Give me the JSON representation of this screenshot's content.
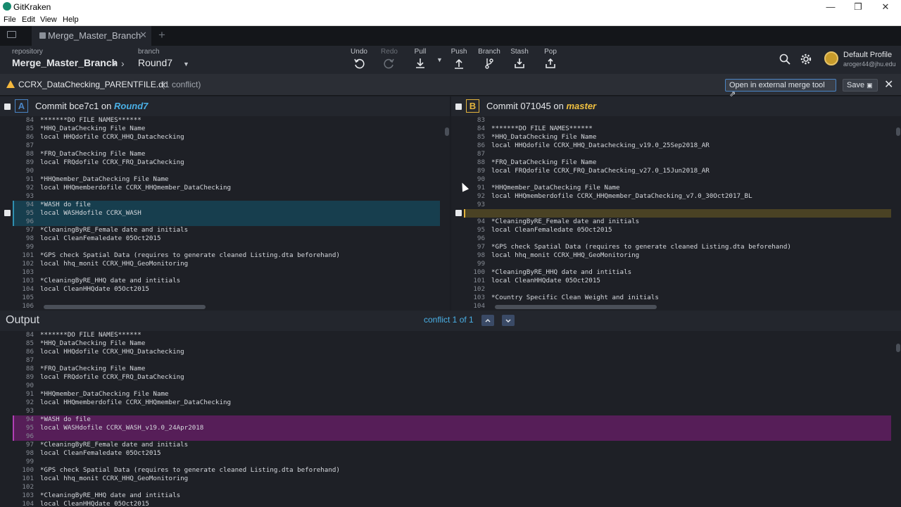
{
  "window": {
    "title": "GitKraken",
    "minimize": "—",
    "maximize": "❐",
    "close": "✕"
  },
  "menu": [
    "File",
    "Edit",
    "View",
    "Help"
  ],
  "tab": {
    "label": "Merge_Master_Branch",
    "close": "✕",
    "add": "+"
  },
  "toolbar": {
    "repository_label": "repository",
    "repository": "Merge_Master_Branch",
    "branch_label": "branch",
    "branch": "Round7",
    "actions": {
      "undo": "Undo",
      "redo": "Redo",
      "pull": "Pull",
      "push": "Push",
      "branch": "Branch",
      "stash": "Stash",
      "pop": "Pop"
    },
    "profile_name": "Default Profile",
    "profile_email": "aroger44@jhu.edu"
  },
  "conflict_bar": {
    "file": "CCRX_DataChecking_PARENTFILE.do",
    "count": "(1 conflict)",
    "external_button": "Open in external merge tool",
    "save_button": "Save"
  },
  "pane_a": {
    "badge": "A",
    "title": "Commit bce7c1 on",
    "branch": "Round7",
    "lines": [
      [
        "84",
        "*******DO FILE NAMES******"
      ],
      [
        "85",
        "*HHQ_DataChecking File Name"
      ],
      [
        "86",
        "local HHQdofile CCRX_HHQ_Datachecking"
      ],
      [
        "87",
        ""
      ],
      [
        "88",
        "*FRQ_DataChecking File Name"
      ],
      [
        "89",
        "local FRQdofile CCRX_FRQ_DataChecking"
      ],
      [
        "90",
        ""
      ],
      [
        "91",
        "*HHQmember_DataChecking File Name"
      ],
      [
        "92",
        "local HHQmemberdofile CCRX_HHQmember_DataChecking"
      ],
      [
        "93",
        ""
      ],
      [
        "94",
        "*WASH do file"
      ],
      [
        "95",
        "local WASHdofile CCRX_WASH"
      ],
      [
        "96",
        ""
      ],
      [
        "97",
        "*CleaningByRE_Female date and initials"
      ],
      [
        "98",
        "local CleanFemaledate 05Oct2015"
      ],
      [
        "99",
        ""
      ],
      [
        "101",
        "*GPS check Spatial Data (requires to generate cleaned Listing.dta beforehand)"
      ],
      [
        "102",
        "local hhq_monit CCRX_HHQ_GeoMonitoring"
      ],
      [
        "103",
        ""
      ],
      [
        "103",
        "*CleaningByRE_HHQ date and intitials"
      ],
      [
        "104",
        "local CleanHHQdate 05Oct2015"
      ],
      [
        "105",
        ""
      ],
      [
        "106",
        ""
      ]
    ]
  },
  "pane_b": {
    "badge": "B",
    "title": "Commit 071045 on",
    "branch": "master",
    "lines": [
      [
        "83",
        ""
      ],
      [
        "84",
        "*******DO FILE NAMES******"
      ],
      [
        "85",
        "*HHQ_DataChecking File Name"
      ],
      [
        "86",
        "local HHQdofile CCRX_HHQ_Datachecking_v19.0_25Sep2018_AR"
      ],
      [
        "87",
        ""
      ],
      [
        "88",
        "*FRQ_DataChecking File Name"
      ],
      [
        "89",
        "local FRQdofile CCRX_FRQ_DataChecking_v27.0_15Jun2018_AR"
      ],
      [
        "90",
        ""
      ],
      [
        "91",
        "*HHQmember_DataChecking File Name"
      ],
      [
        "92",
        "local HHQmemberdofile CCRX_HHQmember_DataChecking_v7.0_30Oct2017_BL"
      ],
      [
        "93",
        ""
      ],
      [
        "",
        ""
      ],
      [
        "94",
        "*CleaningByRE_Female date and initials"
      ],
      [
        "95",
        "local CleanFemaledate 05Oct2015"
      ],
      [
        "96",
        ""
      ],
      [
        "97",
        "*GPS check Spatial Data (requires to generate cleaned Listing.dta beforehand)"
      ],
      [
        "98",
        "local hhq_monit CCRX_HHQ_GeoMonitoring"
      ],
      [
        "99",
        ""
      ],
      [
        "100",
        "*CleaningByRE_HHQ date and intitials"
      ],
      [
        "101",
        "local CleanHHQdate 05Oct2015"
      ],
      [
        "102",
        ""
      ],
      [
        "103",
        "*Country Specific Clean Weight and initials"
      ],
      [
        "104",
        ""
      ]
    ]
  },
  "output": {
    "title": "Output",
    "conflict_nav": "conflict 1 of 1",
    "lines": [
      [
        "84",
        "*******DO FILE NAMES******"
      ],
      [
        "85",
        "*HHQ_DataChecking File Name"
      ],
      [
        "86",
        "local HHQdofile CCRX_HHQ_Datachecking"
      ],
      [
        "87",
        ""
      ],
      [
        "88",
        "*FRQ_DataChecking File Name"
      ],
      [
        "89",
        "local FRQdofile CCRX_FRQ_DataChecking"
      ],
      [
        "90",
        ""
      ],
      [
        "91",
        "*HHQmember_DataChecking File Name"
      ],
      [
        "92",
        "local HHQmemberdofile CCRX_HHQmember_DataChecking"
      ],
      [
        "93",
        ""
      ],
      [
        "94",
        "*WASH do file"
      ],
      [
        "95",
        "local WASHdofile CCRX_WASH_v19.0_24Apr2018"
      ],
      [
        "96",
        ""
      ],
      [
        "97",
        "*CleaningByRE_Female date and initials"
      ],
      [
        "98",
        "local CleanFemaledate 05Oct2015"
      ],
      [
        "99",
        ""
      ],
      [
        "100",
        "*GPS check Spatial Data (requires to generate cleaned Listing.dta beforehand)"
      ],
      [
        "101",
        "local hhq_monit CCRX_HHQ_GeoMonitoring"
      ],
      [
        "102",
        ""
      ],
      [
        "103",
        "*CleaningByRE_HHQ date and intitials"
      ],
      [
        "104",
        "local CleanHHQdate 05Oct2015"
      ]
    ]
  }
}
